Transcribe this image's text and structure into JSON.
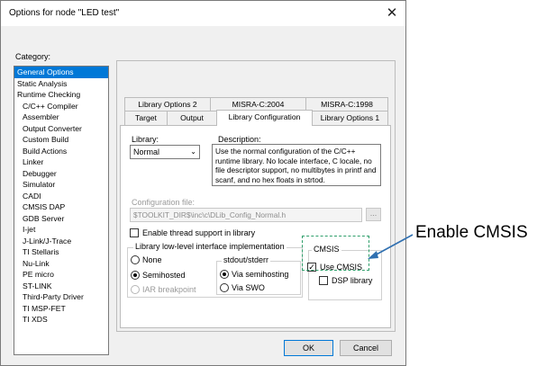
{
  "window": {
    "title": "Options for node \"LED test\"",
    "close_glyph": "✕"
  },
  "category": {
    "label": "Category:",
    "items": [
      {
        "label": "General Options",
        "selected": true,
        "indent": false
      },
      {
        "label": "Static Analysis",
        "indent": false
      },
      {
        "label": "Runtime Checking",
        "indent": false
      },
      {
        "label": "C/C++ Compiler",
        "indent": true
      },
      {
        "label": "Assembler",
        "indent": true
      },
      {
        "label": "Output Converter",
        "indent": true
      },
      {
        "label": "Custom Build",
        "indent": true
      },
      {
        "label": "Build Actions",
        "indent": true
      },
      {
        "label": "Linker",
        "indent": true
      },
      {
        "label": "Debugger",
        "indent": true
      },
      {
        "label": "Simulator",
        "indent": true
      },
      {
        "label": "CADI",
        "indent": true
      },
      {
        "label": "CMSIS DAP",
        "indent": true
      },
      {
        "label": "GDB Server",
        "indent": true
      },
      {
        "label": "I-jet",
        "indent": true
      },
      {
        "label": "J-Link/J-Trace",
        "indent": true
      },
      {
        "label": "TI Stellaris",
        "indent": true
      },
      {
        "label": "Nu-Link",
        "indent": true
      },
      {
        "label": "PE micro",
        "indent": true
      },
      {
        "label": "ST-LINK",
        "indent": true
      },
      {
        "label": "Third-Party Driver",
        "indent": true
      },
      {
        "label": "TI MSP-FET",
        "indent": true
      },
      {
        "label": "TI XDS",
        "indent": true
      }
    ]
  },
  "tabs": {
    "back_row": [
      "Library Options 2",
      "MISRA-C:2004",
      "MISRA-C:1998"
    ],
    "front_row": [
      "Target",
      "Output",
      "Library Configuration",
      "Library Options 1"
    ],
    "active": "Library Configuration"
  },
  "library": {
    "label": "Library:",
    "selected": "Normal",
    "description_label": "Description:",
    "description": "Use the normal configuration of the C/C++ runtime library. No locale interface, C locale, no file descriptor support, no multibytes in printf and scanf, and no hex floats in strtod."
  },
  "config_file": {
    "label": "Configuration file:",
    "value": "$TOOLKIT_DIR$\\inc\\c\\DLib_Config_Normal.h",
    "browse_label": "..."
  },
  "thread_support": {
    "label": "Enable thread support in library",
    "checked": false
  },
  "low_level": {
    "title": "Library low-level interface implementation",
    "options": [
      "None",
      "Semihosted",
      "IAR breakpoint"
    ],
    "selected": "Semihosted"
  },
  "stdout": {
    "title": "stdout/stderr",
    "options": [
      "Via semihosting",
      "Via SWO"
    ],
    "selected": "Via semihosting"
  },
  "cmsis": {
    "title": "CMSIS",
    "use_cmsis": {
      "label": "Use CMSIS",
      "checked": true
    },
    "dsp_library": {
      "label": "DSP library",
      "checked": false
    },
    "check_glyph": "✓"
  },
  "buttons": {
    "ok": "OK",
    "cancel": "Cancel"
  },
  "annotation": {
    "text": "Enable CMSIS"
  },
  "colors": {
    "selection": "#0078d7",
    "annotation_frame": "#2e9e6a",
    "arrow": "#2f6fb0"
  }
}
